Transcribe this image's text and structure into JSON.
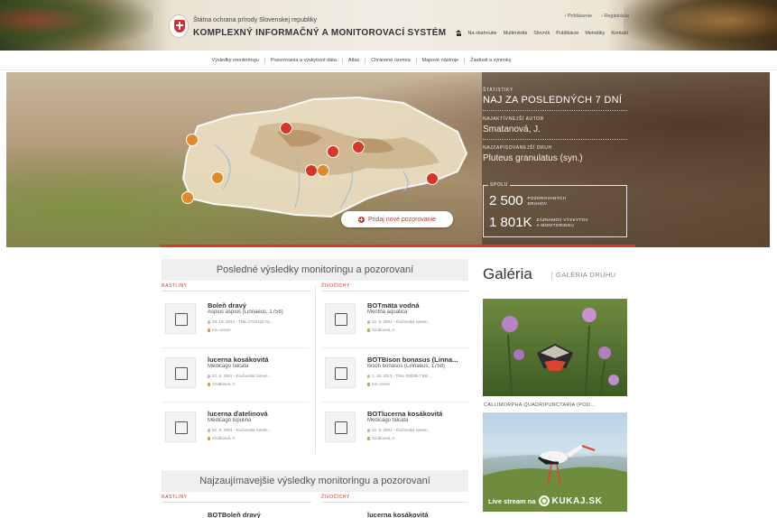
{
  "header": {
    "org_name": "Štátna ochrana prírody Slovenskej republiky",
    "system_name": "KOMPLEXNÝ INFORMAČNÝ A MONITOROVACÍ SYSTÉM",
    "top_links": [
      "Prihlásenie",
      "Registrácia"
    ],
    "util_nav": [
      "Na stiahnutie",
      "Multimédiá",
      "Slovník",
      "Publikácie",
      "Metodiky",
      "Kontakt"
    ]
  },
  "main_nav": [
    "Výsledky monitoringu",
    "Pozorovania a výskytové dáta",
    "Atlas",
    "Chránené územia",
    "Mapové nástroje",
    "Žiadosti a výnimky"
  ],
  "hero": {
    "stats_caption": "ŠTATISTIKY",
    "stats_title": "NAJ ZA POSLEDNÝCH 7 DNÍ",
    "active_author_caption": "NAJAKTÍVNEJŠÍ AUTOR",
    "active_author": "Smatanová, J.",
    "top_species_caption": "NAJZAPISOVANEJŠÍ DRUH",
    "top_species": "Pluteus granulatus (syn.)",
    "totals": {
      "tag": "SPOLU",
      "species_count": "2 500",
      "species_label": "POZOROVANÝCH DRUHOV",
      "records_count": "1 801K",
      "records_label": "ZÁZNAMOV VÝSKYTOV A MONITORINGU"
    },
    "add_button": "Pridaj nové pozorovanie",
    "map_markers": [
      {
        "color": "#e08a2e"
      },
      {
        "color": "#d9362b"
      },
      {
        "color": "#e08a2e"
      },
      {
        "color": "#e08a2e"
      },
      {
        "color": "#d9362b"
      },
      {
        "color": "#d9362b"
      },
      {
        "color": "#d9362b"
      },
      {
        "color": "#e08a2e"
      },
      {
        "color": "#d9362b"
      }
    ]
  },
  "latest": {
    "title": "Posledné výsledky monitoringu a pozorovaní",
    "col_plants": "RASTLINY",
    "col_animals": "ŽIVOČÍCHY",
    "plants": [
      {
        "name": "Boleň dravý",
        "latin": "Aspius aspius (Linnaeus, 1758)",
        "meta": "29. 10. 2013 - TNIL-2743J22 As...",
        "author": "ms ozoncI"
      },
      {
        "name": "lucerna kosákovitá",
        "latin": "Medicago falcata",
        "meta": "22. 8. 2001 - Kručovská ramen...",
        "author": "Szabóová, A."
      },
      {
        "name": "lucerna ďatelinová",
        "latin": "Medicago lupulina",
        "meta": "22. 8. 2001 - Kručovská ramen...",
        "author": "Szabóová, A."
      }
    ],
    "animals": [
      {
        "name": "BOTmäta vodná",
        "latin": "Mentha aquatica",
        "meta": "22. 8. 2001 - Kručovská ramen...",
        "author": "Szabóová, A."
      },
      {
        "name": "BOTBison bonasus (Linna...",
        "latin": "Bison bonasus (Linnaeus, 1758)",
        "meta": "1. 10. 2013 - TNIL-2903B-7 Bis...",
        "author": "ms ozoncI"
      },
      {
        "name": "BOTlucerna kosákovitá",
        "latin": "Medicago falcata",
        "meta": "22. 8. 2001 - Kručovská ramen...",
        "author": "Szabóová, A."
      }
    ]
  },
  "interesting": {
    "title": "Najzaujímavejšie výsledky monitoringu a pozorovaní",
    "col_plants": "RASTLINY",
    "col_animals": "ŽIVOČÍCHY",
    "plant_first": "BOTBoleň dravý",
    "animal_first": "lucerna kosákovitá"
  },
  "gallery": {
    "title": "Galéria",
    "subtitle": "GALÉRIA DRUHU",
    "caption": "CALLIMORPHA QUADRIPUNCTARIA (POD...",
    "live_label": "Live stream na",
    "live_brand": "KUKAJ.SK"
  }
}
